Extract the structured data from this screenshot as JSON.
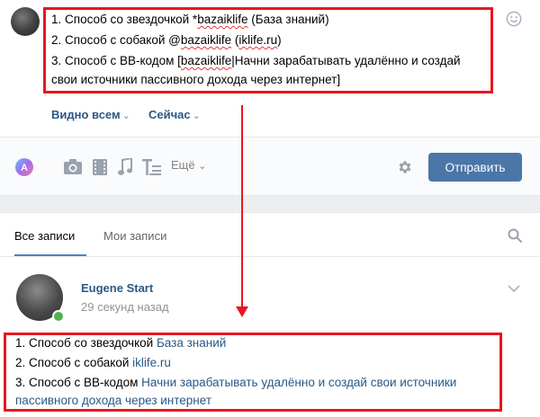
{
  "composer": {
    "line1_prefix": "1. Способ со звездочкой *",
    "line1_nick": "bazaiklife",
    "line1_suffix": " (База знаний)",
    "line2_prefix": "2. Способ с собакой @",
    "line2_nick": "bazaiklife",
    "line2_mid": " (",
    "line2_domain": "iklife.ru",
    "line2_suffix": ")",
    "line3_prefix": "3. Способ с BB-кодом [",
    "line3_nick": "bazaiklife",
    "line3_suffix": "|Начни зарабатывать удалённо и создай",
    "line4": "свои источники пассивного дохода через интернет]",
    "visibility": "Видно всем",
    "timing": "Сейчас"
  },
  "toolbar": {
    "more": "Ещё",
    "send": "Отправить",
    "icons": [
      "poster-icon",
      "camera-icon",
      "video-icon",
      "music-icon",
      "text-format-icon",
      "gear-icon"
    ]
  },
  "tabs": {
    "all": "Все записи",
    "mine": "Мои записи"
  },
  "post": {
    "author": "Eugene Start",
    "time": "29 секунд назад",
    "line1_text": "1. Способ со звездочкой ",
    "line1_link": "База знаний",
    "line2_text": "2. Способ с собакой ",
    "line2_link": "iklife.ru",
    "line3_text": "3. Способ с BB-кодом ",
    "line3_link": "Начни зарабатывать удалённо и создай свои источники",
    "line4_link": "пассивного дохода через интернет"
  },
  "colors": {
    "accent": "#4a76a8",
    "link": "#2a5885",
    "highlight": "#e8171f",
    "online": "#4bb34b"
  }
}
